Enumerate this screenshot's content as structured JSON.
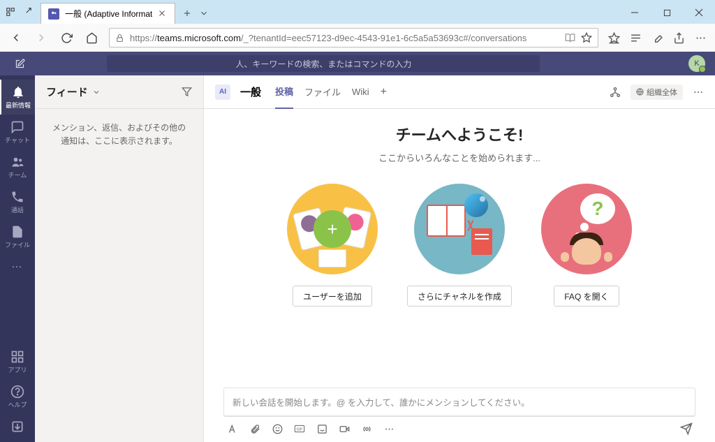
{
  "browser": {
    "tab_title": "一般 (Adaptive Informat",
    "url_scheme": "https://",
    "url_host": "teams.microsoft.com",
    "url_path": "/_?tenantId=eec57123-d9ec-4543-91e1-6c5a5a53693c#/conversations"
  },
  "teams_header": {
    "search_placeholder": "人、キーワードの検索、またはコマンドの入力",
    "avatar_initial": "K"
  },
  "rail": {
    "items": [
      {
        "label": "最新情報"
      },
      {
        "label": "チャット"
      },
      {
        "label": "チーム"
      },
      {
        "label": "通話"
      },
      {
        "label": "ファイル"
      }
    ],
    "more": "…",
    "bottom": [
      {
        "label": "アプリ"
      },
      {
        "label": "ヘルプ"
      }
    ]
  },
  "feed": {
    "title": "フィード",
    "empty_message": "メンション、返信、およびその他の通知は、ここに表示されます。"
  },
  "channel": {
    "team_initials": "AI",
    "name": "一般",
    "tabs": [
      {
        "label": "投稿"
      },
      {
        "label": "ファイル"
      },
      {
        "label": "Wiki"
      }
    ],
    "org_scope": "組織全体"
  },
  "welcome": {
    "title": "チームへようこそ!",
    "subtitle": "ここからいろんなことを始められます...",
    "cards": [
      {
        "button": "ユーザーを追加"
      },
      {
        "button": "さらにチャネルを作成"
      },
      {
        "button": "FAQ を開く"
      }
    ]
  },
  "compose": {
    "placeholder": "新しい会話を開始します。@ を入力して、誰かにメンションしてください。"
  }
}
